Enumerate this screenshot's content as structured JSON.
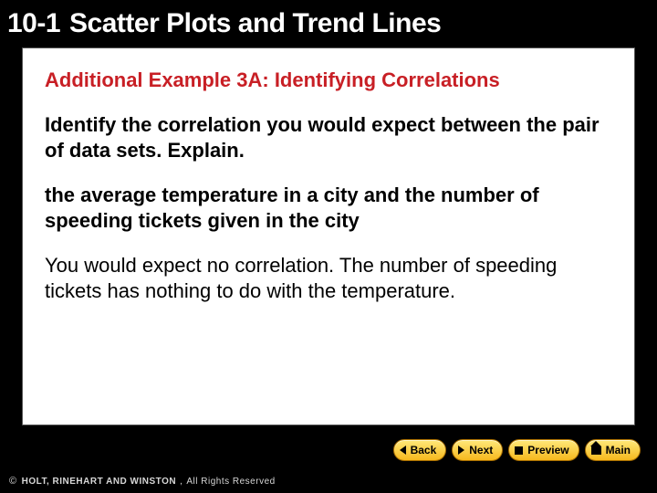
{
  "header": {
    "section_number": "10-1",
    "section_title": "Scatter Plots and Trend Lines"
  },
  "content": {
    "heading": "Additional Example 3A: Identifying Correlations",
    "prompt": "Identify the correlation you would expect between the pair of data sets. Explain.",
    "datasets": "the average temperature in a city and the number of speeding tickets given in the city",
    "answer": "You would expect no correlation. The number of speeding tickets has nothing to do with the temperature."
  },
  "nav": {
    "back": "Back",
    "next": "Next",
    "preview": "Preview",
    "main": "Main"
  },
  "footer": {
    "copyright_symbol": "©",
    "brand": "HOLT, RINEHART AND WINSTON",
    "comma": ",",
    "rights": "All Rights Reserved"
  }
}
